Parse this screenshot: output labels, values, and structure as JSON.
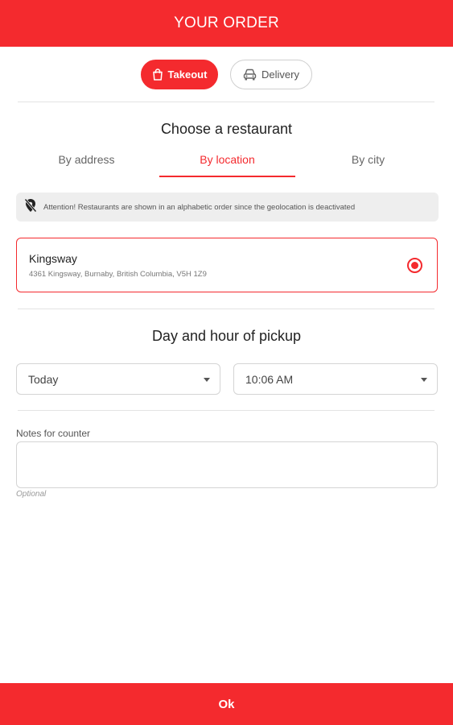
{
  "header": {
    "title": "YOUR ORDER"
  },
  "order_mode": {
    "takeout": {
      "label": "Takeout",
      "icon": "shopping-bag-icon",
      "selected": true
    },
    "delivery": {
      "label": "Delivery",
      "icon": "car-icon",
      "selected": false
    }
  },
  "restaurant_section": {
    "title": "Choose a restaurant",
    "tabs": [
      {
        "label": "By address",
        "active": false
      },
      {
        "label": "By location",
        "active": true
      },
      {
        "label": "By city",
        "active": false
      }
    ],
    "notice": {
      "icon": "location-off-icon",
      "text": "Attention! Restaurants are shown in an alphabetic order since the geolocation is deactivated"
    },
    "restaurants": [
      {
        "name": "Kingsway",
        "address": "4361 Kingsway, Burnaby, British Columbia, V5H 1Z9",
        "selected": true
      }
    ]
  },
  "pickup_section": {
    "title": "Day and hour of pickup",
    "day": {
      "value": "Today"
    },
    "time": {
      "value": "10:06 AM"
    }
  },
  "notes": {
    "label": "Notes for counter",
    "value": "",
    "hint": "Optional"
  },
  "footer": {
    "ok_label": "Ok"
  },
  "colors": {
    "accent": "#f42a2e",
    "divider": "#e3e3e3",
    "notice_bg": "#eeeeee"
  }
}
